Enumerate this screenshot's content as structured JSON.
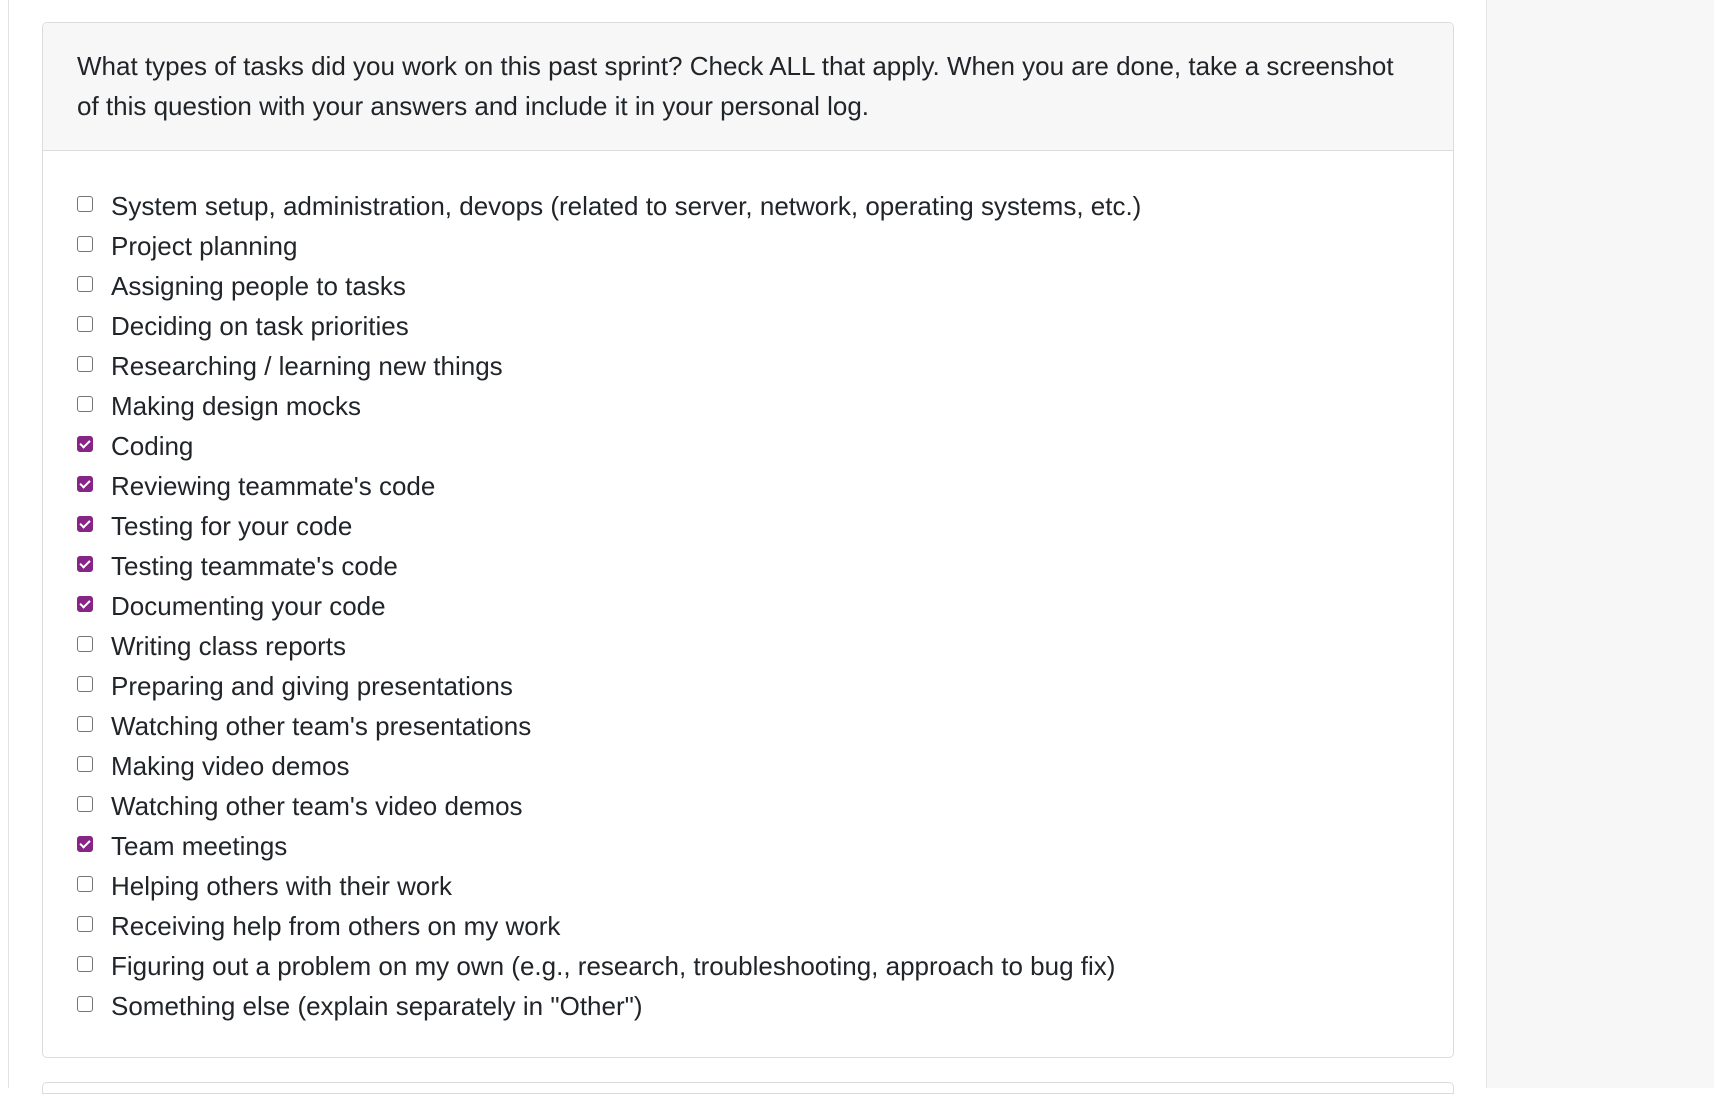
{
  "question": {
    "text": "What types of tasks did you work on this past sprint? Check ALL that apply. When you are done, take a screenshot of this question with your answers and include it in your personal log.",
    "options": [
      {
        "label": "System setup, administration, devops (related to server, network, operating systems, etc.)",
        "checked": false
      },
      {
        "label": "Project planning",
        "checked": false
      },
      {
        "label": "Assigning people to tasks",
        "checked": false
      },
      {
        "label": "Deciding on task priorities",
        "checked": false
      },
      {
        "label": "Researching / learning new things",
        "checked": false
      },
      {
        "label": "Making design mocks",
        "checked": false
      },
      {
        "label": "Coding",
        "checked": true
      },
      {
        "label": "Reviewing teammate's code",
        "checked": true
      },
      {
        "label": "Testing for your code",
        "checked": true
      },
      {
        "label": "Testing teammate's code",
        "checked": true
      },
      {
        "label": "Documenting your code",
        "checked": true
      },
      {
        "label": "Writing class reports",
        "checked": false
      },
      {
        "label": "Preparing and giving presentations",
        "checked": false
      },
      {
        "label": "Watching other team's presentations",
        "checked": false
      },
      {
        "label": "Making video demos",
        "checked": false
      },
      {
        "label": "Watching other team's video demos",
        "checked": false
      },
      {
        "label": "Team meetings",
        "checked": true
      },
      {
        "label": "Helping others with their work",
        "checked": false
      },
      {
        "label": "Receiving help from others on my work",
        "checked": false
      },
      {
        "label": "Figuring out a problem on my own (e.g., research, troubleshooting, approach to bug fix)",
        "checked": false
      },
      {
        "label": "Something else (explain separately in \"Other\")",
        "checked": false
      }
    ]
  },
  "colors": {
    "checkbox_checked": "#862585",
    "header_background": "#f7f7f7",
    "border": "#dcdcdc",
    "text": "#212529"
  }
}
